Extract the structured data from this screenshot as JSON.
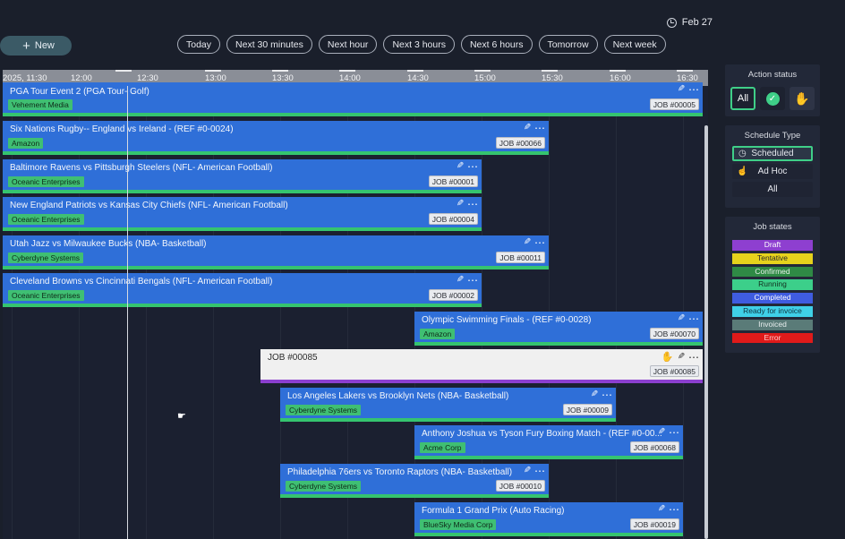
{
  "header": {
    "date": "Feb 27",
    "new_label": "New",
    "filters": [
      "Today",
      "Next 30 minutes",
      "Next hour",
      "Next 3 hours",
      "Next 6 hours",
      "Tomorrow",
      "Next week"
    ]
  },
  "timeline": {
    "ticks": [
      "2025, 11:30",
      "12:00",
      "12:30",
      "13:00",
      "13:30",
      "14:00",
      "14:30",
      "15:00",
      "15:30",
      "16:00",
      "16:30"
    ],
    "jobs": [
      {
        "title": "PGA Tour Event 2 (PGA Tour- Golf)",
        "client": "Vehement Media",
        "job": "JOB #00005"
      },
      {
        "title": "Six Nations Rugby-- England vs Ireland - (REF #0-0024)",
        "client": "Amazon",
        "job": "JOB #00066"
      },
      {
        "title": "Baltimore Ravens vs Pittsburgh Steelers (NFL- American Football)",
        "client": "Oceanic Enterprises",
        "job": "JOB #00001"
      },
      {
        "title": "New England Patriots vs Kansas City Chiefs (NFL- American Football)",
        "client": "Oceanic Enterprises",
        "job": "JOB #00004"
      },
      {
        "title": "Utah Jazz vs Milwaukee Bucks (NBA- Basketball)",
        "client": "Cyberdyne Systems",
        "job": "JOB #00011"
      },
      {
        "title": "Cleveland Browns vs Cincinnati Bengals (NFL- American Football)",
        "client": "Oceanic Enterprises",
        "job": "JOB #00002"
      },
      {
        "title": "Olympic Swimming Finals - (REF #0-0028)",
        "client": "Amazon",
        "job": "JOB #00070"
      },
      {
        "title": "JOB #00085",
        "client": "",
        "job": "JOB #00085"
      },
      {
        "title": "Los Angeles Lakers vs Brooklyn Nets (NBA- Basketball)",
        "client": "Cyberdyne Systems",
        "job": "JOB #00009"
      },
      {
        "title": "Anthony Joshua vs Tyson Fury Boxing Match - (REF #0-00...",
        "client": "Acme Corp",
        "job": "JOB #00068"
      },
      {
        "title": "Philadelphia 76ers vs Toronto Raptors (NBA- Basketball)",
        "client": "Cyberdyne Systems",
        "job": "JOB #00010"
      },
      {
        "title": "Formula 1 Grand Prix (Auto Racing)",
        "client": "BlueSky Media Corp",
        "job": "JOB #00019"
      }
    ]
  },
  "action_status": {
    "title": "Action status",
    "all_label": "All"
  },
  "schedule_type": {
    "title": "Schedule Type",
    "items": [
      "Scheduled",
      "Ad Hoc",
      "All"
    ]
  },
  "job_states": {
    "title": "Job states",
    "items": [
      {
        "label": "Draft",
        "color": "#8e3fd0",
        "text": "#ffffff"
      },
      {
        "label": "Tentative",
        "color": "#e6d21c",
        "text": "#2a2a2a"
      },
      {
        "label": "Confirmed",
        "color": "#2f8a45",
        "text": "#e8f0ea"
      },
      {
        "label": "Running",
        "color": "#3ccf8a",
        "text": "#12301f"
      },
      {
        "label": "Completed",
        "color": "#3f5ce0",
        "text": "#ffffff"
      },
      {
        "label": "Ready for invoice",
        "color": "#3fd0e8",
        "text": "#103440"
      },
      {
        "label": "Invoiced",
        "color": "#5a7b78",
        "text": "#e8eeee"
      },
      {
        "label": "Error",
        "color": "#e01a1a",
        "text": "#ffd0d0"
      }
    ]
  }
}
